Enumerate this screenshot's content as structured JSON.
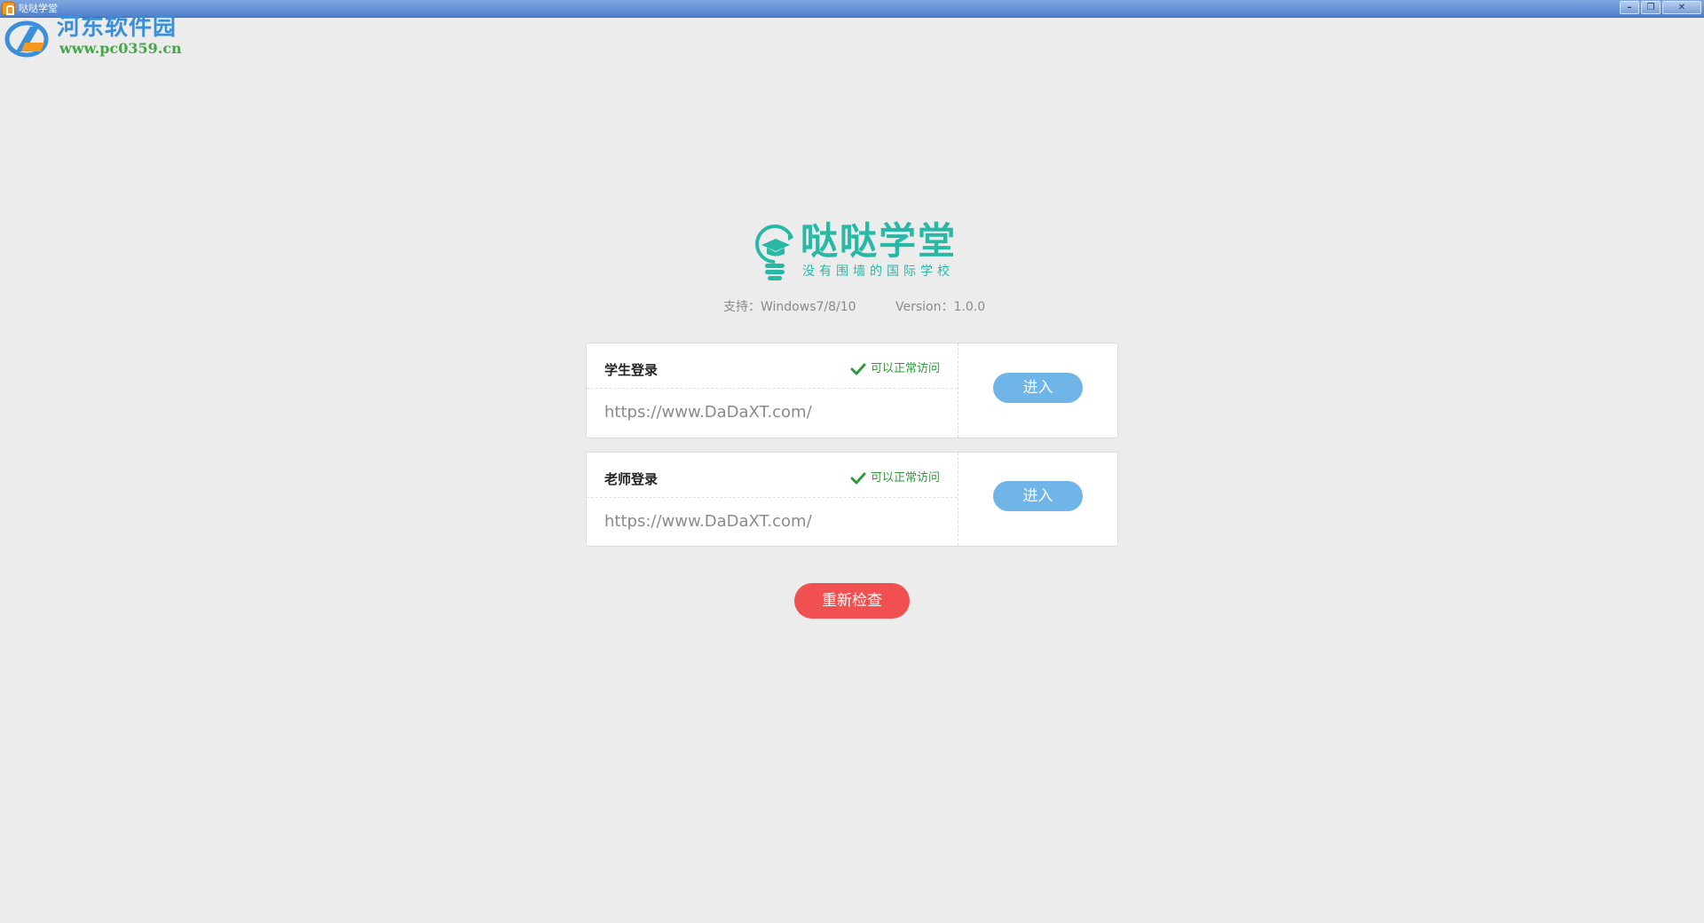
{
  "window": {
    "title": "哒哒学堂",
    "minimize_glyph": "–",
    "maximize_glyph": "❐",
    "close_glyph": "✕"
  },
  "watermark": {
    "title": "河东软件园",
    "url": "www.pc0359.cn"
  },
  "brand": {
    "name": "哒哒学堂",
    "slogan": "没有围墙的国际学校",
    "color": "#28b8a6"
  },
  "info": {
    "support": "支持：Windows7/8/10",
    "version": "Version：1.0.0"
  },
  "logins": [
    {
      "label": "学生登录",
      "status": "可以正常访问",
      "url": "https://www.DaDaXT.com/",
      "button": "进入"
    },
    {
      "label": "老师登录",
      "status": "可以正常访问",
      "url": "https://www.DaDaXT.com/",
      "button": "进入"
    }
  ],
  "actions": {
    "recheck": "重新检查"
  },
  "colors": {
    "background": "#ececec",
    "status_ok": "#2e9a3a",
    "enter_button": "#6fb5e8",
    "recheck_button": "#f05050"
  }
}
